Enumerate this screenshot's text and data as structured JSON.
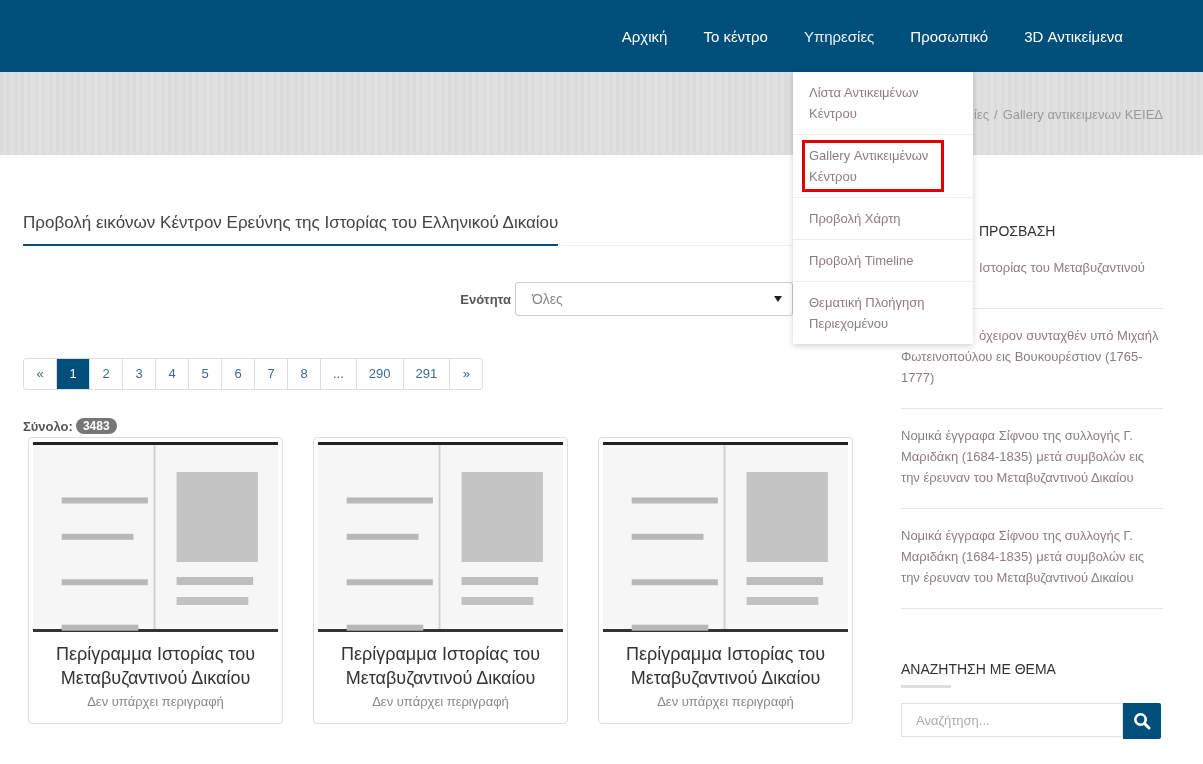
{
  "nav": [
    {
      "label": "Αρχική",
      "selected": false
    },
    {
      "label": "Το κέντρο",
      "selected": false
    },
    {
      "label": "Υπηρεσίες",
      "selected": true
    },
    {
      "label": "Προσωπικό",
      "selected": false
    },
    {
      "label": "3D Αντικείμενα",
      "selected": false
    }
  ],
  "dropdown": [
    {
      "label": "Λίστα Αντικειμένων Κέντρου",
      "highlighted": false
    },
    {
      "label": "Gallery Αντικειμένων Κέντρου",
      "highlighted": true
    },
    {
      "label": "Προβολή Χάρτη",
      "highlighted": false
    },
    {
      "label": "Προβολή Timeline",
      "highlighted": false
    },
    {
      "label": "Θεματική Πλοήγηση Περιεχομένου",
      "highlighted": false
    }
  ],
  "breadcrumb": {
    "link": "ίες",
    "separator": "/",
    "current": "Gallery αντικειμενων ΚΕΙΕΔ"
  },
  "page_title": "Προβολή εικόνων Κέντρον Ερεύνης της Ιστορίας του Ελληνικού Δικαίου",
  "filter": {
    "label": "Ενότητα",
    "value": "Όλες"
  },
  "pagination": [
    {
      "label": "«",
      "selected": false
    },
    {
      "label": "1",
      "selected": true
    },
    {
      "label": "2",
      "selected": false
    },
    {
      "label": "3",
      "selected": false
    },
    {
      "label": "4",
      "selected": false
    },
    {
      "label": "5",
      "selected": false
    },
    {
      "label": "6",
      "selected": false
    },
    {
      "label": "7",
      "selected": false
    },
    {
      "label": "8",
      "selected": false
    },
    {
      "label": "...",
      "selected": false
    },
    {
      "label": "290",
      "selected": false
    },
    {
      "label": "291",
      "selected": false
    },
    {
      "label": "»",
      "selected": false
    }
  ],
  "total": {
    "label": "Σύνολο:",
    "count": "3483"
  },
  "cards": [
    {
      "title": "Περίγραμμα Ιστορίας του Μεταβυζαντινού Δικαίου",
      "description": "Δεν υπάρχει περιγραφή"
    },
    {
      "title": "Περίγραμμα Ιστορίας του Μεταβυζαντινού Δικαίου",
      "description": "Δεν υπάρχει περιγραφή"
    },
    {
      "title": "Περίγραμμα Ιστορίας του Μεταβυζαντινού Δικαίου",
      "description": "Δεν υπάρχει περιγραφή"
    }
  ],
  "sidebar": {
    "heading": "ΠΡΟΣΒΑΣΗ",
    "items": [
      {
        "lines": [
          "Ιστορίας του Μεταβυζαντινού"
        ],
        "kind": "covered"
      },
      {
        "lines": [
          "όχειρον συνταχθέν υπό Μιχαήλ",
          "Φωτεινοπούλου εις Βουκουρέστιον (1765-1777)"
        ],
        "kind": "covered"
      },
      {
        "lines": [
          "Νομικά έγγραφα Σίφνου της συλλογής Γ. Μαριδάκη (1684-1835) μετά συμβολών εις την έρευναν του Μεταβυζαντινού Δικαίου"
        ],
        "kind": "full"
      },
      {
        "lines": [
          "Νομικά έγγραφα Σίφνου της συλλογής Γ. Μαριδάκη (1684-1835) μετά συμβολών εις την έρευναν του Μεταβυζαντινού Δικαίου"
        ],
        "kind": "full"
      }
    ],
    "search_heading": "ΑΝΑΖΗΤΗΣΗ ΜΕ ΘΕΜΑ",
    "search_placeholder": "Αναζήτηση..."
  }
}
